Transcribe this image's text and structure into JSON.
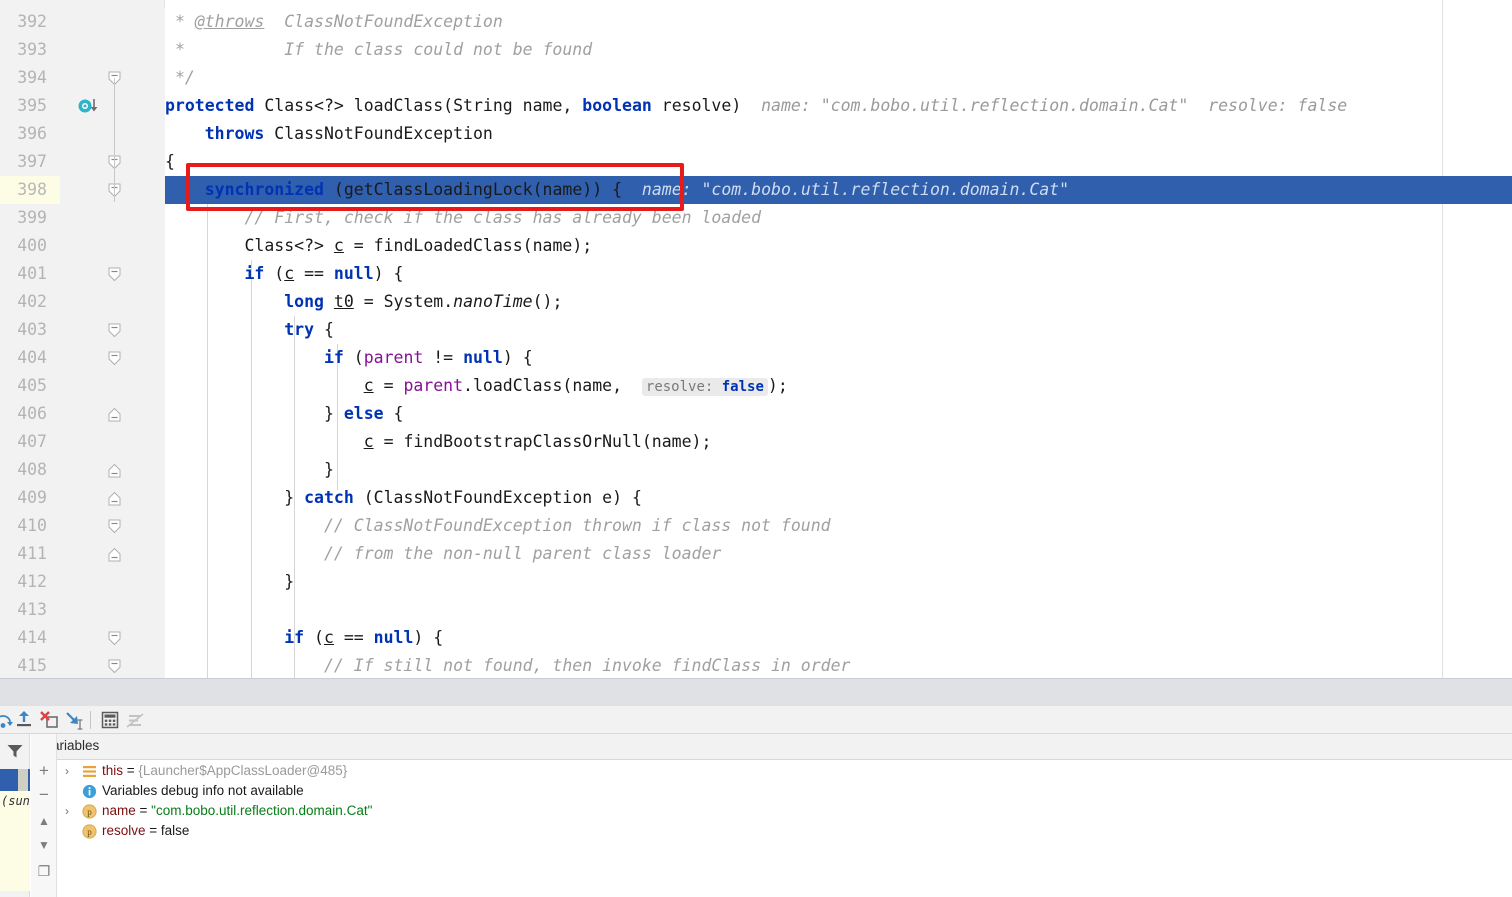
{
  "editor": {
    "first_line_number": 392,
    "current_line": 398,
    "selected_line": 398,
    "colors": {
      "selection_blue": "#2f5fad",
      "current_line_yellow": "#fdfce5",
      "keyword_blue": "#0033b3",
      "comment_gray": "#a0a0a0",
      "field_purple": "#871094",
      "string_green": "#067d17",
      "annotation_red": "#e81a1a"
    },
    "lines": [
      {
        "n": 392,
        "text": " * @throws  ClassNotFoundException"
      },
      {
        "n": 393,
        "text": " *          If the class could not be found"
      },
      {
        "n": 394,
        "text": " */"
      },
      {
        "n": 395,
        "text": "protected Class<?> loadClass(String name, boolean resolve)",
        "hints": "name: \"com.bobo.util.reflection.domain.Cat\"  resolve: false"
      },
      {
        "n": 396,
        "text": "    throws ClassNotFoundException"
      },
      {
        "n": 397,
        "text": "{"
      },
      {
        "n": 398,
        "text": "    synchronized (getClassLoadingLock(name)) {",
        "hints": "name: \"com.bobo.util.reflection.domain.Cat\""
      },
      {
        "n": 399,
        "text": "        // First, check if the class has already been loaded"
      },
      {
        "n": 400,
        "text": "        Class<?> c = findLoadedClass(name);"
      },
      {
        "n": 401,
        "text": "        if (c == null) {"
      },
      {
        "n": 402,
        "text": "            long t0 = System.nanoTime();"
      },
      {
        "n": 403,
        "text": "            try {"
      },
      {
        "n": 404,
        "text": "                if (parent != null) {"
      },
      {
        "n": 405,
        "text": "                    c = parent.loadClass(name,  resolve: false);",
        "chip": "resolve: false"
      },
      {
        "n": 406,
        "text": "                } else {"
      },
      {
        "n": 407,
        "text": "                    c = findBootstrapClassOrNull(name);"
      },
      {
        "n": 408,
        "text": "                }"
      },
      {
        "n": 409,
        "text": "            } catch (ClassNotFoundException e) {"
      },
      {
        "n": 410,
        "text": "                // ClassNotFoundException thrown if class not found"
      },
      {
        "n": 411,
        "text": "                // from the non-null parent class loader"
      },
      {
        "n": 412,
        "text": "            }"
      },
      {
        "n": 413,
        "text": ""
      },
      {
        "n": 414,
        "text": "            if (c == null) {"
      },
      {
        "n": 415,
        "text": "                // If still not found, then invoke findClass in order"
      }
    ],
    "gutter_icons": {
      "line_395": "method-override-icon"
    }
  },
  "debug_toolbar": {
    "buttons": [
      {
        "name": "step-over-icon",
        "label": "Step Over"
      },
      {
        "name": "step-out-icon",
        "label": "Step Out"
      },
      {
        "name": "force-step-into-icon",
        "label": "Force Step Into"
      },
      {
        "name": "drop-frame-icon",
        "label": "Drop Frame"
      },
      {
        "name": "evaluate-expression-icon",
        "label": "Evaluate Expression"
      },
      {
        "name": "mute-breakpoints-icon",
        "label": "Mute Breakpoints"
      }
    ]
  },
  "frames": {
    "filter_icon": "filter-icon",
    "selected_frame_label": "",
    "truncated_frame_text": "(sun."
  },
  "vars_toolbar": {
    "add_label": "+",
    "remove_label": "−",
    "up_label": "▲",
    "down_label": "▼",
    "copy_label": "❐"
  },
  "variables_panel": {
    "tab_label": "Variables",
    "rows": [
      {
        "expandable": true,
        "icon": "object-value-icon",
        "name": "this",
        "name_class": "vn-this",
        "eq": " = ",
        "value": "{Launcher$AppClassLoader@485}",
        "value_class": "vv-ref"
      },
      {
        "expandable": false,
        "icon": "info-icon",
        "name": "Variables debug info not available",
        "name_class": "vi-text",
        "eq": "",
        "value": "",
        "value_class": "vv-ref"
      },
      {
        "expandable": true,
        "icon": "parameter-icon",
        "name": "name",
        "name_class": "vn-param",
        "eq": " = ",
        "value": "\"com.bobo.util.reflection.domain.Cat\"",
        "value_class": "vv-str"
      },
      {
        "expandable": false,
        "icon": "parameter-icon",
        "name": "resolve",
        "name_class": "vn-param",
        "eq": " = ",
        "value": "false",
        "value_class": "vv-bool"
      }
    ]
  }
}
